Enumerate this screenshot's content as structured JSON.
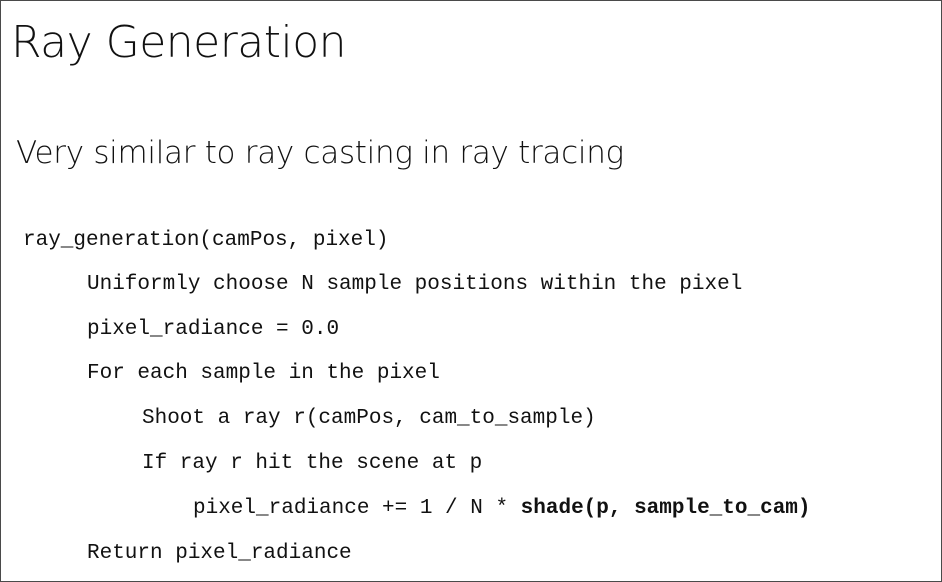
{
  "slide": {
    "title": "Ray Generation",
    "subtitle": "Very similar to ray casting in ray tracing",
    "code": {
      "line0": "ray_generation(camPos, pixel)",
      "line1": "Uniformly choose N sample positions within the pixel",
      "line2": "pixel_radiance = 0.0",
      "line3": "For each sample in the pixel",
      "line4": "Shoot a ray r(camPos, cam_to_sample)",
      "line5": "If ray r hit the scene at p",
      "line6_normal": "pixel_radiance += 1 / N * ",
      "line6_bold": "shade(p, sample_to_cam)",
      "line7": "Return pixel_radiance"
    }
  }
}
